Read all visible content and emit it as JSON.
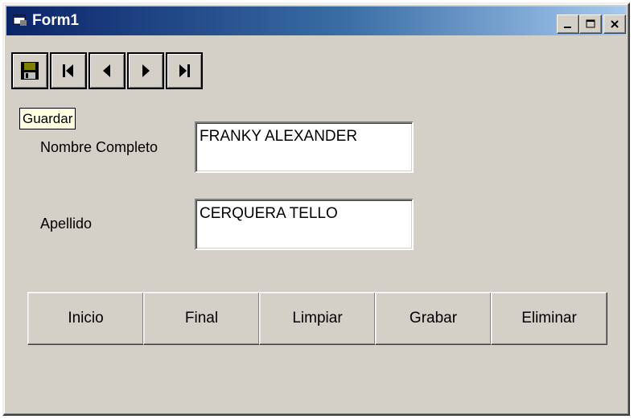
{
  "window": {
    "title": "Form1",
    "controls": {
      "minimize_icon": "minimize-icon",
      "maximize_icon": "maximize-icon",
      "close_icon": "close-icon"
    }
  },
  "toolbar": {
    "buttons": [
      {
        "icon": "save-icon"
      },
      {
        "icon": "first-record-icon"
      },
      {
        "icon": "previous-record-icon"
      },
      {
        "icon": "next-record-icon"
      },
      {
        "icon": "last-record-icon"
      }
    ],
    "tooltip": "Guardar"
  },
  "form": {
    "nombre_label": "Nombre Completo",
    "nombre_value": "FRANKY ALEXANDER",
    "apellido_label": "Apellido",
    "apellido_value": "CERQUERA TELLO"
  },
  "actions": {
    "inicio": "Inicio",
    "final": "Final",
    "limpiar": "Limpiar",
    "grabar": "Grabar",
    "eliminar": "Eliminar"
  },
  "colors": {
    "titlebar_start": "#0a246a",
    "titlebar_end": "#a6caf0",
    "face": "#d4d0c8",
    "tooltip_bg": "#ffffe1"
  }
}
